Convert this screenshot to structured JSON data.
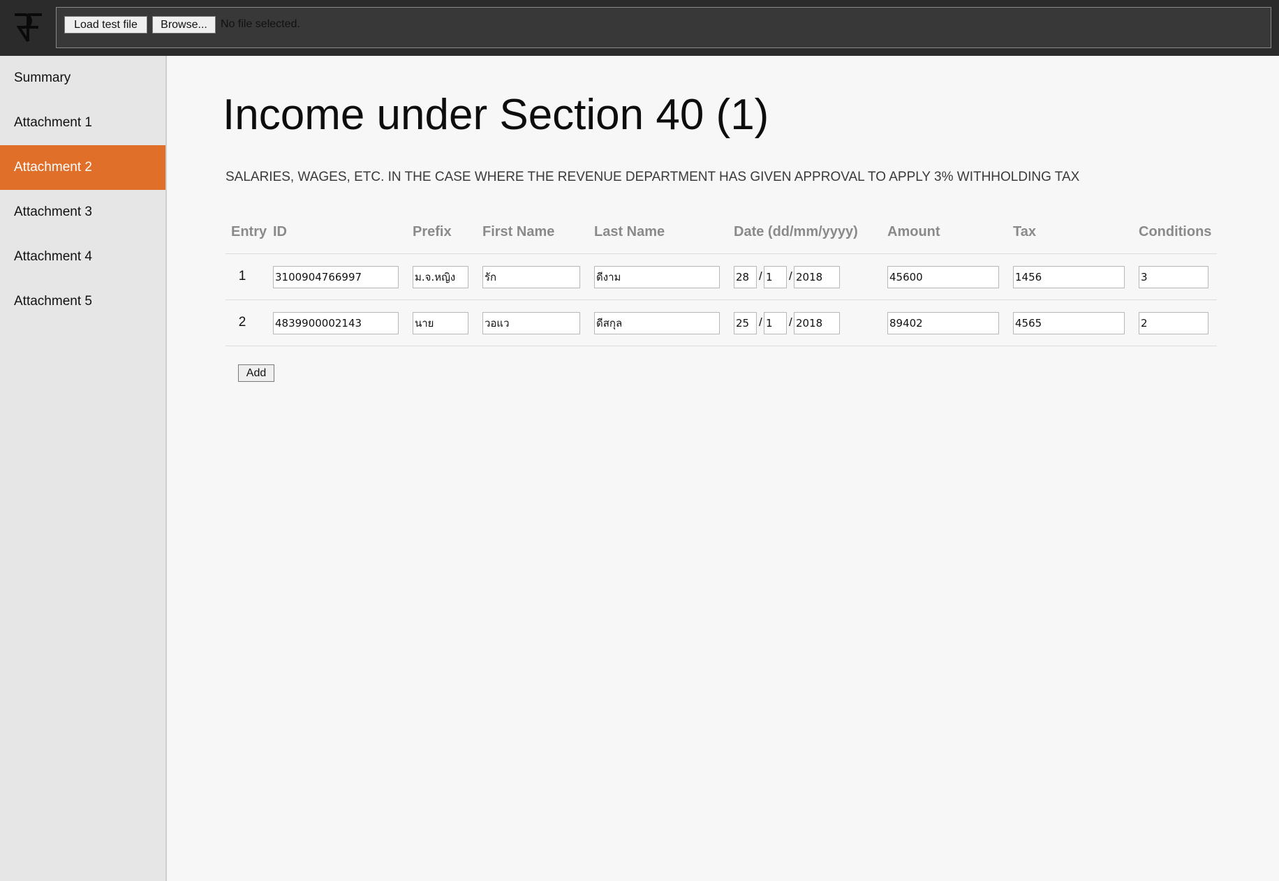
{
  "app": {
    "logo_text": "RF"
  },
  "toolbar": {
    "load_label": "Load test file",
    "browse_label": "Browse...",
    "file_status": "No file selected."
  },
  "sidebar": {
    "items": [
      {
        "label": "Summary",
        "active": false
      },
      {
        "label": "Attachment 1",
        "active": false
      },
      {
        "label": "Attachment 2",
        "active": true
      },
      {
        "label": "Attachment 3",
        "active": false
      },
      {
        "label": "Attachment 4",
        "active": false
      },
      {
        "label": "Attachment 5",
        "active": false
      }
    ]
  },
  "main": {
    "title": "Income under Section 40 (1)",
    "subtitle": "SALARIES, WAGES, ETC. IN THE CASE WHERE THE REVENUE DEPARTMENT HAS GIVEN APPROVAL TO APPLY 3% WITHHOLDING TAX",
    "columns": {
      "entry": "Entry",
      "id": "ID",
      "prefix": "Prefix",
      "first_name": "First Name",
      "last_name": "Last Name",
      "date": "Date (dd/mm/yyyy)",
      "amount": "Amount",
      "tax": "Tax",
      "conditions": "Conditions"
    },
    "rows": [
      {
        "entry": "1",
        "id": "3100904766997",
        "prefix": "ม.จ.หญิง",
        "first_name": "รัก",
        "last_name": "ดีงาม",
        "day": "28",
        "month": "1",
        "year": "2018",
        "amount": "45600",
        "tax": "1456",
        "conditions": "3"
      },
      {
        "entry": "2",
        "id": "4839900002143",
        "prefix": "นาย",
        "first_name": "วอแว",
        "last_name": "ดีสกุล",
        "day": "25",
        "month": "1",
        "year": "2018",
        "amount": "89402",
        "tax": "4565",
        "conditions": "2"
      }
    ],
    "date_separator": "/",
    "add_label": "Add"
  },
  "colors": {
    "topbar": "#2b2b2b",
    "active_nav": "#e06f2a",
    "sidebar": "#e6e6e6",
    "content_bg": "#f7f7f7"
  }
}
